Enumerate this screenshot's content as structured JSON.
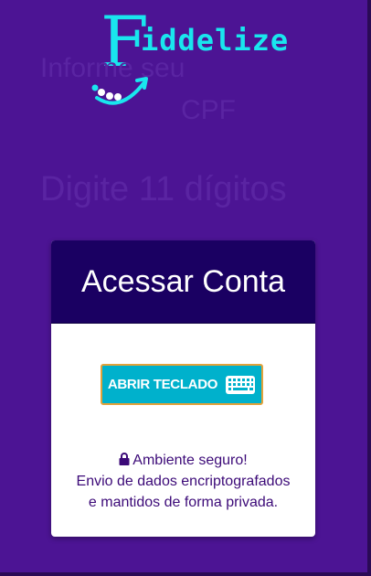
{
  "logo": {
    "first_letter": "F",
    "rest": "iddelize"
  },
  "ghost_prompts": {
    "line1": "Informe seu",
    "line2": "CPF",
    "line3": "Digite 11 dígitos"
  },
  "card": {
    "title": "Acessar Conta",
    "keyboard_button_label": "ABRIR TECLADO",
    "secure_title": "Ambiente seguro!",
    "secure_line1": "Envio de dados encriptografados",
    "secure_line2": "e mantidos de forma privada."
  },
  "colors": {
    "background": "#4c1494",
    "card_header": "#1a0062",
    "button": "#00b1cc",
    "button_border": "#e2a23a",
    "logo": "#19e6ee",
    "secure_text": "#3c0a78"
  },
  "icons": {
    "keyboard": "keyboard-icon",
    "lock": "lock-icon",
    "smile": "smile-icon"
  }
}
